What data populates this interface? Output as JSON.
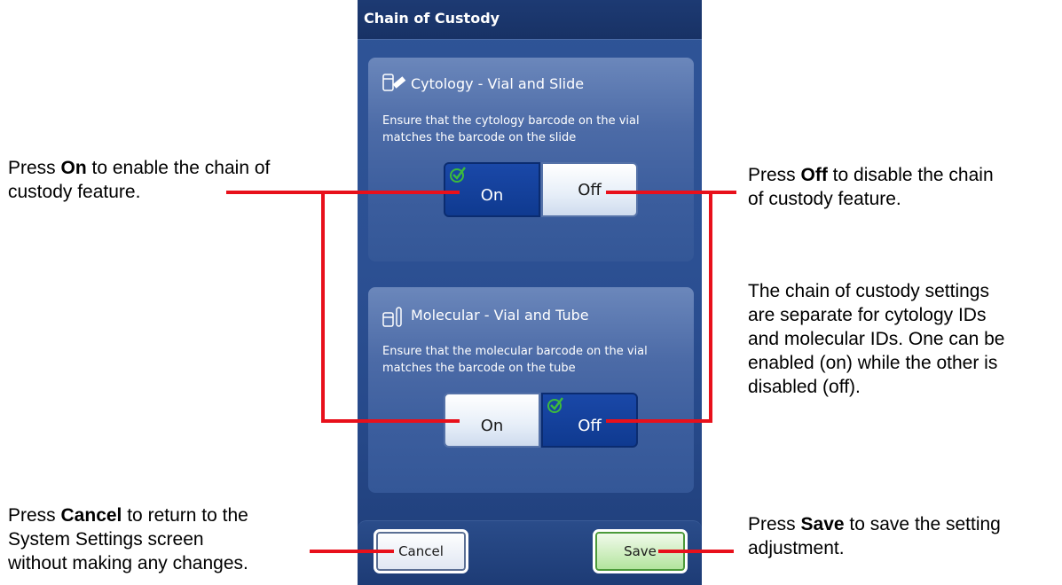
{
  "screen": {
    "title": "Chain of Custody",
    "cytology": {
      "title": "Cytology - Vial and Slide",
      "icon": "vial-slide-icon",
      "desc_line1": "Ensure that the cytology barcode on the vial",
      "desc_line2": "matches the barcode on the slide",
      "on_label": "On",
      "off_label": "Off",
      "selected": "On"
    },
    "molecular": {
      "title": "Molecular - Vial and Tube",
      "icon": "vial-tube-icon",
      "desc_line1": "Ensure that the molecular barcode on the vial",
      "desc_line2": "matches the barcode on the tube",
      "on_label": "On",
      "off_label": "Off",
      "selected": "Off"
    },
    "cancel_label": "Cancel",
    "save_label": "Save"
  },
  "annotations": {
    "on": {
      "pre": "Press ",
      "bold": "On",
      "rest": " to enable the chain of",
      "line2": "custody feature."
    },
    "off": {
      "pre": "Press ",
      "bold": "Off",
      "rest": " to disable the chain",
      "line2": "of custody feature."
    },
    "separate": {
      "line1": "The chain of custody settings",
      "line2": "are separate for cytology IDs",
      "line3": "and molecular IDs. One can be",
      "line4": "enabled (on) while the other is",
      "line5": "disabled (off)."
    },
    "cancel": {
      "pre": "Press ",
      "bold": "Cancel",
      "rest": " to return to the",
      "line2": "System Settings screen",
      "line3": "without making any changes."
    },
    "save": {
      "pre": "Press ",
      "bold": "Save",
      "rest": " to save the setting",
      "line2": "adjustment."
    }
  },
  "colors": {
    "callout_line": "#e8101b",
    "selected_toggle": "#1a48a8",
    "check": "#3dbb3d"
  }
}
